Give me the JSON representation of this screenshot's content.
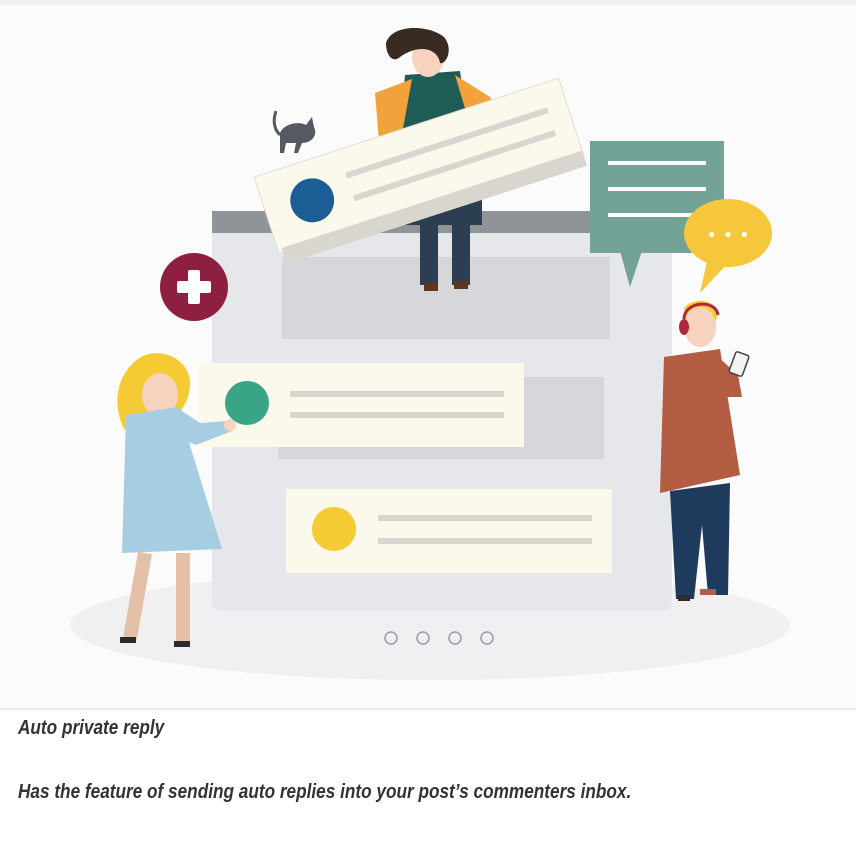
{
  "feature": {
    "title": "Auto private reply",
    "description": "Has the feature of sending auto replies into your post’s commenters inbox."
  },
  "illustration": {
    "bubble_dots": "• • •",
    "carousel": {
      "dot_count": 4
    }
  },
  "colors": {
    "background": "#fbfbfc",
    "window": "#e6e7ea",
    "window_bar": "#8f949a",
    "card": "#fbf8ec",
    "teal_bubble": "#72a396",
    "yellow_bubble": "#f6c73b",
    "plus_badge": "#8e1f40",
    "text": "#333333"
  },
  "icons": [
    "plus-icon",
    "chat-bubble-icon",
    "typing-bubble-icon",
    "phone-icon",
    "cat-icon"
  ]
}
